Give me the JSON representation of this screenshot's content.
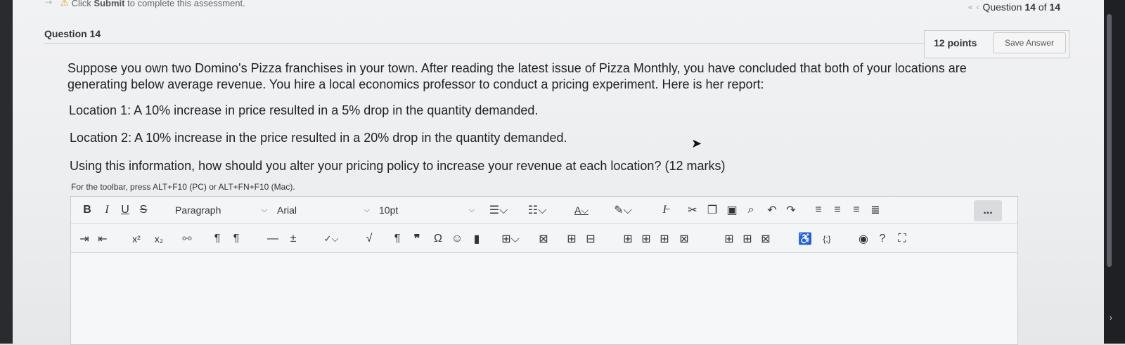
{
  "notice": {
    "prefix": "Click ",
    "bold": "Submit",
    "suffix": " to complete this assessment."
  },
  "nav": {
    "label_pre": "Question ",
    "current": "14",
    "of": " of ",
    "total": "14"
  },
  "question": {
    "title": "Question 14",
    "points": "12 points",
    "save_label": "Save Answer",
    "intro": "Suppose you own two Domino's Pizza franchises in your town. After reading the latest issue of Pizza Monthly, you have concluded that both of your locations are generating below average revenue. You hire a local economics professor to conduct a pricing experiment. Here is her report:",
    "location1": "Location 1: A 10% increase in price resulted in a 5% drop in the quantity demanded.",
    "location2": "Location 2: A 10% increase in the price resulted in a 20% drop in the quantity demanded.",
    "prompt": "Using this information, how should you alter your pricing policy to increase your revenue at each location? (12 marks)"
  },
  "editor": {
    "hint": "For the toolbar, press ALT+F10 (PC) or ALT+FN+F10 (Mac).",
    "bold": "B",
    "italic": "I",
    "underline": "U",
    "strike": "S",
    "paragraph": "Paragraph",
    "font": "Arial",
    "size": "10pt",
    "superscript": "x²",
    "subscript": "x₂",
    "more": "..."
  },
  "colors": {
    "accent_warn": "#d9a400",
    "nav_icon": "#99aabb",
    "editor_bg": "#f4f5f6"
  },
  "icons": [
    "warning-icon",
    "chevron-double-left-icon",
    "chevron-left-icon",
    "bullet-list-icon",
    "numbered-list-icon",
    "text-color-icon",
    "highlight-icon",
    "clear-format-icon",
    "cut-icon",
    "copy-icon",
    "paste-icon",
    "search-icon",
    "undo-icon",
    "redo-icon",
    "align-left-icon",
    "align-center-icon",
    "align-right-icon",
    "justify-icon",
    "indent-icon",
    "outdent-icon",
    "link-icon",
    "ltr-icon",
    "rtl-icon",
    "horizontal-rule-icon",
    "plus-minus-icon",
    "spellcheck-icon",
    "math-icon",
    "pilcrow-icon",
    "quote-icon",
    "omega-icon",
    "emoji-icon",
    "bookmark-icon",
    "table-icon",
    "accessibility-icon",
    "code-icon",
    "preview-icon",
    "help-icon",
    "fullscreen-icon"
  ]
}
